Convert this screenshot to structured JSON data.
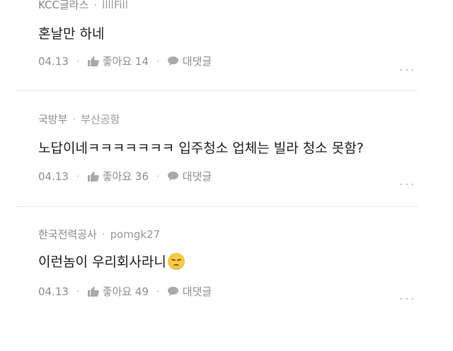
{
  "comments": [
    {
      "company": "KCC글라스",
      "nickname": "llllFill",
      "text": "혼날만 하네",
      "date": "04.13",
      "like_label": "좋아요",
      "like_count": "14",
      "reply_label": "대댓글",
      "emoji": ""
    },
    {
      "company": "국방부",
      "nickname": "부산공항",
      "text": "노답이네ㅋㅋㅋㅋㅋㅋㅋ 입주청소 업체는 빌라 청소 못함?",
      "date": "04.13",
      "like_label": "좋아요",
      "like_count": "36",
      "reply_label": "대댓글",
      "emoji": ""
    },
    {
      "company": "한국전력공사",
      "nickname": "pomgk27",
      "text": "이런놈이 우리회사라니",
      "date": "04.13",
      "like_label": "좋아요",
      "like_count": "49",
      "reply_label": "대댓글",
      "emoji": "pensive-face"
    }
  ],
  "separator_dot": "·",
  "more_glyph": "...",
  "colors": {
    "meta": "#8a8a8a",
    "text": "#1f1f1f",
    "divider": "#e8e8e8"
  }
}
